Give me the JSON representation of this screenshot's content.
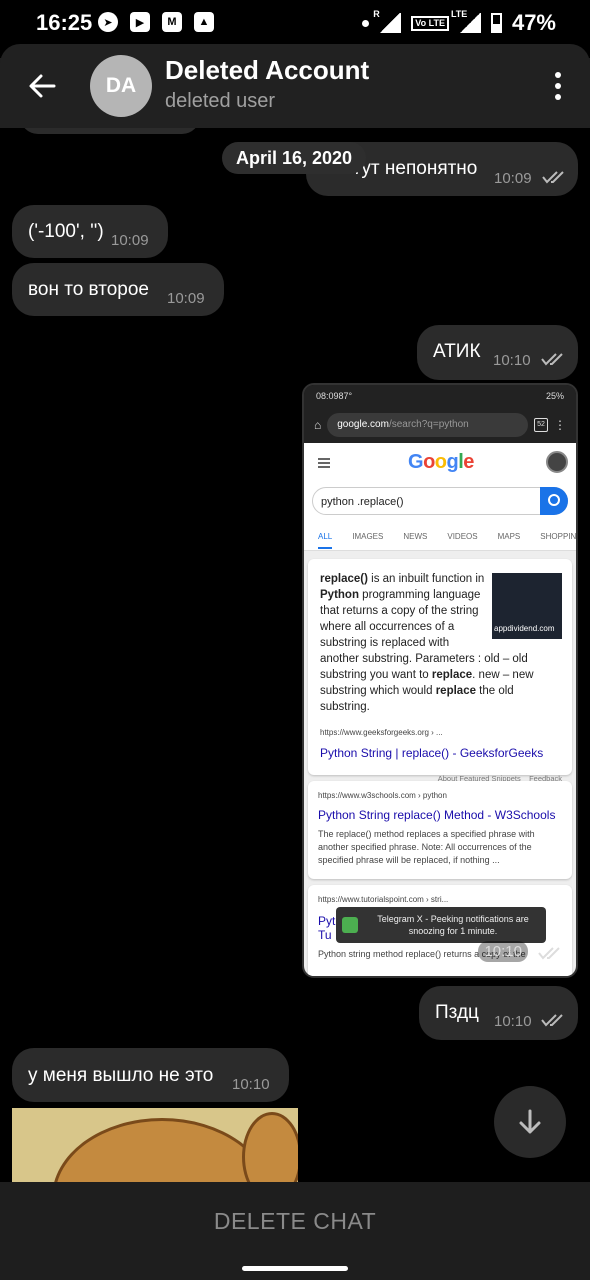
{
  "status_bar": {
    "time": "16:25",
    "battery": "47%",
    "left_icons": [
      "telegram-icon",
      "youtube-icon",
      "gmail-icon",
      "gallery-icon"
    ],
    "right_icons": [
      "dot-icon",
      "signal-r-icon",
      "volte-icon",
      "lte-signal-icon",
      "battery-icon"
    ],
    "roaming_label": "R",
    "volte_label": "Vo LTE",
    "lte_label": "LTE"
  },
  "header": {
    "avatar_initials": "DA",
    "avatar_color": "#b5b5b5",
    "title": "Deleted Account",
    "subtitle": "deleted user"
  },
  "date_chip": "April 16, 2020",
  "messages": [
    {
      "id": "m1",
      "direction": "out",
      "text": "Чё тут непонятно",
      "time": "10:09",
      "read": true
    },
    {
      "id": "m2",
      "direction": "in",
      "text": "('-100', '')",
      "time": "10:09"
    },
    {
      "id": "m3",
      "direction": "in",
      "text": "вон то второе",
      "time": "10:09"
    },
    {
      "id": "m4",
      "direction": "out",
      "text": "АТИК",
      "time": "10:10",
      "read": true
    },
    {
      "id": "m5",
      "direction": "out",
      "type": "photo",
      "time": "10:10",
      "read": true
    },
    {
      "id": "m6",
      "direction": "out",
      "text": "Пздц",
      "time": "10:10",
      "read": true
    },
    {
      "id": "m7",
      "direction": "in",
      "text": "у меня вышло не это",
      "time": "10:10"
    },
    {
      "id": "m8",
      "direction": "in",
      "type": "sticker"
    }
  ],
  "screenshot": {
    "status_time": "08:09",
    "status_temp": "87°",
    "status_battery": "25%",
    "url_host": "google.com",
    "url_path": "/search?q=python",
    "tab_count": "52",
    "logo": "Google",
    "query": "python .replace()",
    "tabs": [
      "ALL",
      "IMAGES",
      "NEWS",
      "VIDEOS",
      "MAPS",
      "SHOPPIN"
    ],
    "featured": {
      "pre": "replace()",
      "text1": " is an inbuilt function in ",
      "bold2": "Python",
      "text2": " programming language that returns a copy of the string where all occurrences of a substring is replaced with another substring. Parameters : old – old substring you want to ",
      "bold3": "replace",
      "text3": ". new – new substring which would ",
      "bold4": "replace",
      "text4": " the old substring.",
      "thumb_caption": "appdividend.com",
      "source": "https://www.geeksforgeeks.org › ...",
      "link": "Python String | replace() - GeeksforGeeks",
      "about": "About Featured Snippets",
      "feedback": "Feedback"
    },
    "result2": {
      "source": "https://www.w3schools.com › python",
      "link": "Python String replace() Method - W3Schools",
      "desc": "The replace() method replaces a specified phrase with another specified phrase. Note: All occurrences of the specified phrase will be replaced, if nothing ..."
    },
    "result3": {
      "source": "https://www.tutorialspoint.com › stri...",
      "link_line1": "Pyt",
      "link_line2": "Tu",
      "desc": "Python string method replace() returns a copy of the"
    },
    "toast": "Telegram X - Peeking notifications are snoozing for 1 minute."
  },
  "bottom_action": "DELETE CHAT",
  "colors": {
    "background": "#000000",
    "bubble": "#2b2b2b",
    "header": "#212121",
    "bottom_bar": "#1e1e1e",
    "google_blue": "#1a73e8"
  }
}
